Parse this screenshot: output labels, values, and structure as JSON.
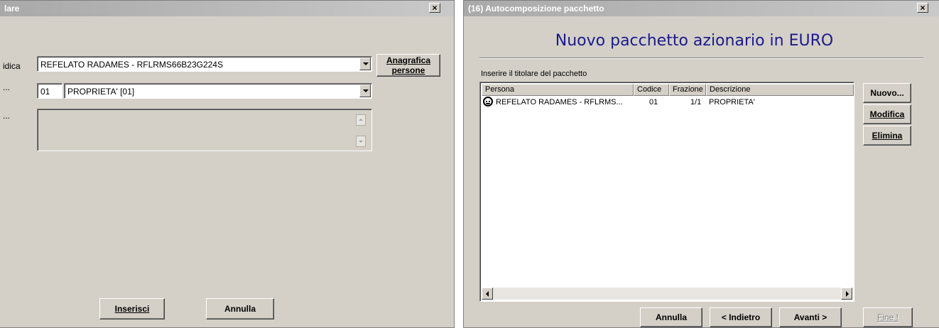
{
  "left_dialog": {
    "title": "lare",
    "close_glyph": "×",
    "fields": {
      "person_label": "idica",
      "person_value": "REFELATO RADAMES - RFLRMS66B23G224S",
      "code_label": "...",
      "code_value": "01",
      "right_value": "PROPRIETA' [01]",
      "notes_label": "..."
    },
    "anagrafica_button": {
      "line1": "Anagrafica",
      "line2": "persone"
    },
    "buttons": {
      "insert": "Inserisci",
      "cancel": "Annulla"
    }
  },
  "right_dialog": {
    "title": "(16) Autocomposizione pacchetto",
    "close_glyph": "×",
    "heading": "Nuovo pacchetto azionario in EURO",
    "heading_color": "#1a1a8c",
    "instruction": "Inserire il titolare del pacchetto",
    "columns": [
      "Persona",
      "Codice",
      "Frazione",
      "Descrizione"
    ],
    "rows": [
      {
        "person": "REFELATO RADAMES - RFLRMS...",
        "code": "01",
        "fraction": "1/1",
        "description": "PROPRIETA'",
        "icon": "person-icon"
      }
    ],
    "side_buttons": {
      "new": "Nuovo...",
      "edit": "Modifica",
      "delete": "Elimina"
    },
    "nav_buttons": {
      "cancel": "Annulla",
      "back": "< Indietro",
      "next": "Avanti >",
      "finish": "Fine !"
    }
  }
}
